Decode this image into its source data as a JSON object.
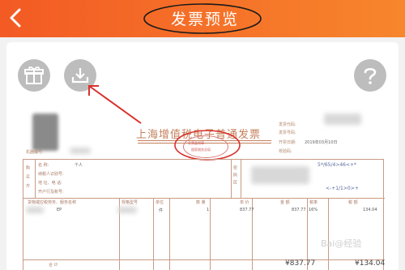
{
  "header": {
    "title": "发票预览",
    "back_icon": "chevron-left-icon",
    "background": "#f35a24"
  },
  "actions": {
    "gift_icon": "gift-icon",
    "download_icon": "download-icon",
    "help_icon": "help-icon"
  },
  "annotation": {
    "color": "#d9302c"
  },
  "invoice": {
    "title": "上海增值税电子普通发票",
    "stamp_line1": "发票监制章",
    "stamp_line2": "国家税务总局",
    "issue_date_label": "开票日期:",
    "issue_date": "2019年03月10日",
    "code_label": "发票代码:",
    "number_label": "发票号码:",
    "check_label": "校验码:",
    "machine_label": "机器编号:",
    "buyer_name": "个人",
    "buyer_side_label": "购买方",
    "buyer_fields": [
      "名      称:",
      "纳税人识别号:",
      "地 址、电 话:",
      "开户行及账号:"
    ],
    "cipher_side_label": "密码区",
    "cipher_text": "5*/65/4>46<+*",
    "cipher_text2": "<-+1/1>0>+",
    "items_header": [
      "货物或应税劳务、服务名称",
      "规格型号",
      "单位",
      "数 量",
      "单 价",
      "金 额",
      "税率",
      "税 额"
    ],
    "item_row": {
      "name": "EP",
      "unit": "件",
      "qty": "1",
      "price": "837.77",
      "amount": "837.77",
      "rate": "16%",
      "tax": "134.04"
    },
    "sum_label": "合      计",
    "sum_amount": "¥837.77",
    "sum_tax": "¥134.04"
  },
  "watermark": "Bai@经验"
}
